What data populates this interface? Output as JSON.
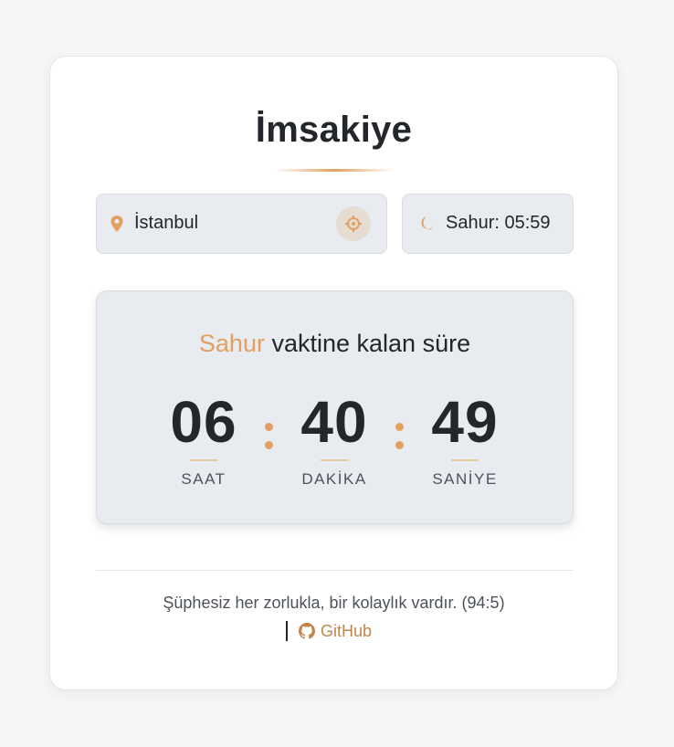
{
  "app": {
    "title": "İmsakiye"
  },
  "location": {
    "value": "İstanbul",
    "pin_icon": "map-pin-icon",
    "locate_icon": "crosshair-icon"
  },
  "sahur_time": {
    "label": "Sahur: 05:59",
    "icon": "moon-icon"
  },
  "countdown": {
    "heading_accent": "Sahur",
    "heading_rest": " vaktine kalan süre",
    "hours": "06",
    "minutes": "40",
    "seconds": "49",
    "hours_label": "SAAT",
    "minutes_label": "DAKİKA",
    "seconds_label": "SANİYE"
  },
  "footer": {
    "quote": "Şüphesiz her zorlukla, bir kolaylık vardır. (94:5)",
    "github_label": "GitHub",
    "github_icon": "github-icon"
  },
  "colors": {
    "accent": "#e2a060",
    "link": "#c2854a",
    "text": "#23262b",
    "panel": "#e8ebef"
  }
}
